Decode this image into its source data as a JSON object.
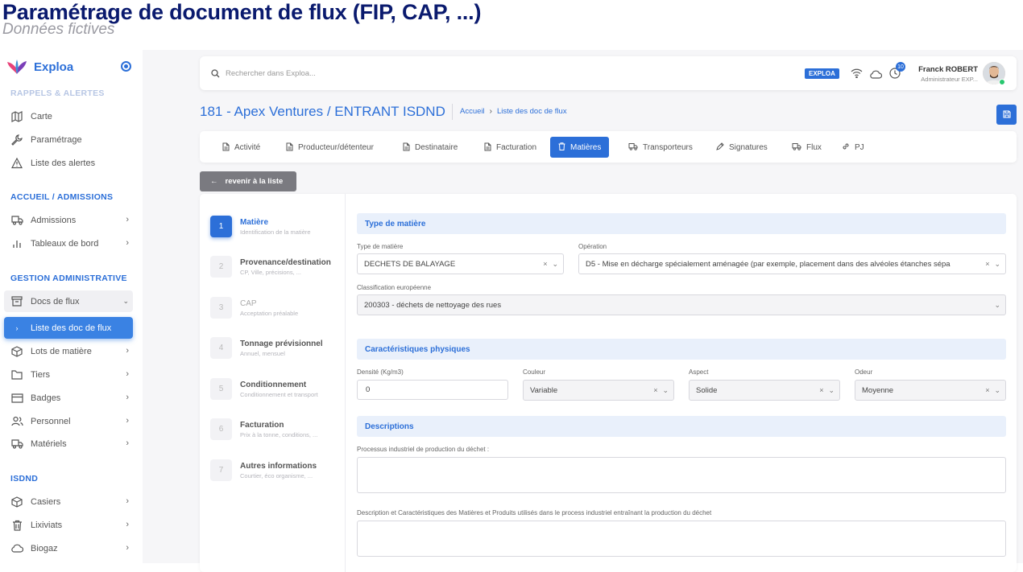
{
  "page": {
    "title": "Paramétrage de document de flux (FIP, CAP, ...)",
    "subtitle": "Données fictives"
  },
  "colors": {
    "accent": "#2c6fd8",
    "active_nav": "#3a82e3",
    "section_bg": "#e9f0fb",
    "online": "#28c76f"
  },
  "sidebar": {
    "app_name": "Exploa",
    "sections": [
      {
        "title": "RAPPELS & ALERTES",
        "items": [
          {
            "label": "Carte",
            "icon": "map-icon"
          },
          {
            "label": "Paramétrage",
            "icon": "wrench-icon"
          },
          {
            "label": "Liste des alertes",
            "icon": "alert-triangle-icon"
          }
        ]
      },
      {
        "title": "ACCUEIL / ADMISSIONS",
        "items": [
          {
            "label": "Admissions",
            "icon": "truck-icon"
          },
          {
            "label": "Tableaux de bord",
            "icon": "bar-chart-icon"
          }
        ]
      },
      {
        "title": "GESTION ADMINISTRATIVE",
        "items": [
          {
            "label": "Docs de flux",
            "icon": "archive-icon"
          },
          {
            "label": "Liste des doc de flux",
            "icon": "chevron-right-icon"
          },
          {
            "label": "Lots de matière",
            "icon": "box-icon"
          },
          {
            "label": "Tiers",
            "icon": "folder-icon"
          },
          {
            "label": "Badges",
            "icon": "credit-card-icon"
          },
          {
            "label": "Personnel",
            "icon": "users-icon"
          },
          {
            "label": "Matériels",
            "icon": "truck-icon"
          }
        ]
      },
      {
        "title": "ISDND",
        "items": [
          {
            "label": "Casiers",
            "icon": "box-icon"
          },
          {
            "label": "Lixiviats",
            "icon": "trash-icon"
          },
          {
            "label": "Biogaz",
            "icon": "cloud-icon"
          }
        ]
      }
    ]
  },
  "topbar": {
    "search_placeholder": "Rechercher dans Exploa...",
    "env_badge": "EXPLOA",
    "notification_count": "10",
    "user_name": "Franck ROBERT",
    "user_role": "Administrateur EXP..."
  },
  "header": {
    "record_title": "181 - Apex Ventures / ENTRANT ISDND",
    "breadcrumb": [
      "Accueil",
      "Liste des doc de flux"
    ]
  },
  "tabs": [
    {
      "label": "Activité",
      "icon": "file-icon"
    },
    {
      "label": "Producteur/détenteur",
      "icon": "file-icon"
    },
    {
      "label": "Destinataire",
      "icon": "file-icon"
    },
    {
      "label": "Facturation",
      "icon": "file-icon"
    },
    {
      "label": "Matières",
      "icon": "trash-icon"
    },
    {
      "label": "Transporteurs",
      "icon": "truck-icon"
    },
    {
      "label": "Signatures",
      "icon": "pen-icon"
    },
    {
      "label": "Flux",
      "icon": "truck-icon"
    },
    {
      "label": "PJ",
      "icon": "link-icon"
    }
  ],
  "back_button": "revenir à la liste",
  "steps": [
    {
      "num": "1",
      "title": "Matière",
      "sub": "Identification de la matière"
    },
    {
      "num": "2",
      "title": "Provenance/destination",
      "sub": "CP, Ville, précisions, ..."
    },
    {
      "num": "3",
      "title": "CAP",
      "sub": "Acceptation préalable"
    },
    {
      "num": "4",
      "title": "Tonnage prévisionnel",
      "sub": "Annuel, mensuel"
    },
    {
      "num": "5",
      "title": "Conditionnement",
      "sub": "Conditionnement et transport"
    },
    {
      "num": "6",
      "title": "Facturation",
      "sub": "Prix à la tonne, conditions, ..."
    },
    {
      "num": "7",
      "title": "Autres informations",
      "sub": "Courtier, éco organisme, ..."
    }
  ],
  "form": {
    "section_type": "Type de matière",
    "type_matiere": {
      "label": "Type de matière",
      "value": "DECHETS DE BALAYAGE"
    },
    "operation": {
      "label": "Opération",
      "value": "D5 - Mise en décharge spécialement aménagée (par exemple, placement dans des alvéoles étanches sépa"
    },
    "classification": {
      "label": "Classification européenne",
      "value": "200303 - déchets de nettoyage des rues"
    },
    "section_physique": "Caractéristiques physiques",
    "densite": {
      "label": "Densité (Kg/m3)",
      "value": "0"
    },
    "couleur": {
      "label": "Couleur",
      "value": "Variable"
    },
    "aspect": {
      "label": "Aspect",
      "value": "Solide"
    },
    "odeur": {
      "label": "Odeur",
      "value": "Moyenne"
    },
    "section_descriptions": "Descriptions",
    "processus_label": "Processus industriel de production du déchet :",
    "description_label": "Description et Caractéristiques des Matières et Produits utilisés dans le process industriel entraînant la production du déchet"
  }
}
